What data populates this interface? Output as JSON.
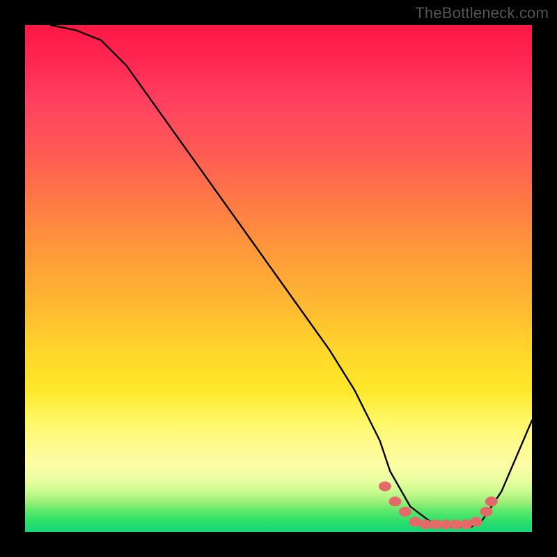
{
  "watermark": "TheBottleneck.com",
  "chart_data": {
    "type": "line",
    "title": "",
    "xlabel": "",
    "ylabel": "",
    "xlim": [
      0,
      100
    ],
    "ylim": [
      0,
      100
    ],
    "series": [
      {
        "name": "curve",
        "x": [
          5,
          10,
          15,
          20,
          25,
          30,
          35,
          40,
          45,
          50,
          55,
          60,
          65,
          70,
          72,
          76,
          80,
          84,
          88,
          90,
          94,
          100
        ],
        "y": [
          100,
          99,
          97,
          92,
          85,
          78,
          71,
          64,
          57,
          50,
          43,
          36,
          28,
          18,
          12,
          5,
          2,
          1,
          1,
          2,
          8,
          22
        ]
      }
    ],
    "markers": {
      "name": "dots",
      "color": "#e46a6a",
      "points": [
        {
          "x": 71,
          "y": 9
        },
        {
          "x": 73,
          "y": 6
        },
        {
          "x": 75,
          "y": 4
        },
        {
          "x": 77,
          "y": 2
        },
        {
          "x": 79,
          "y": 1.5
        },
        {
          "x": 81,
          "y": 1.5
        },
        {
          "x": 83,
          "y": 1.5
        },
        {
          "x": 85,
          "y": 1.5
        },
        {
          "x": 87,
          "y": 1.5
        },
        {
          "x": 89,
          "y": 2
        },
        {
          "x": 91,
          "y": 4
        },
        {
          "x": 92,
          "y": 6
        }
      ]
    }
  }
}
